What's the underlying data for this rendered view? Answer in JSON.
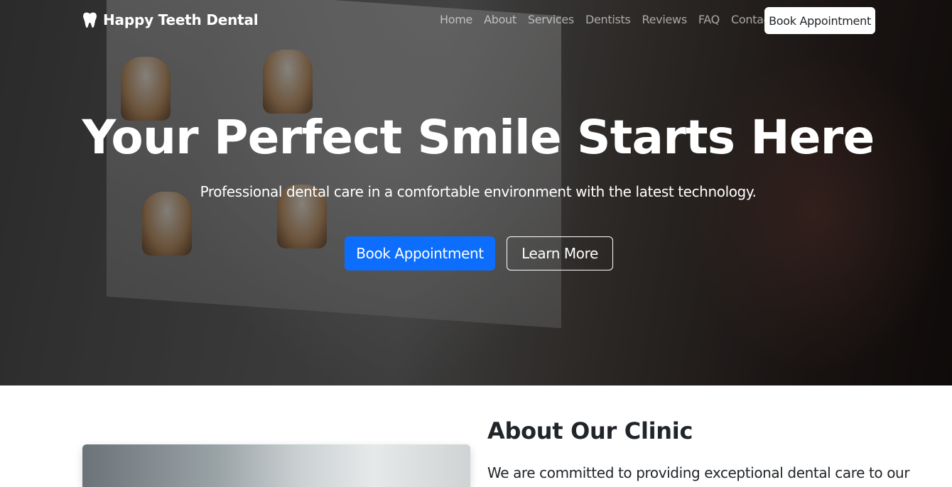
{
  "brand": {
    "name": "Happy Teeth Dental",
    "icon": "tooth-icon"
  },
  "nav": {
    "links": [
      "Home",
      "About",
      "Services",
      "Dentists",
      "Reviews",
      "FAQ",
      "Contact"
    ],
    "cta": "Book Appointment"
  },
  "hero": {
    "title": "Your Perfect Smile Starts Here",
    "subtitle": "Professional dental care in a comfortable environment with the latest technology.",
    "primary_button": "Book Appointment",
    "secondary_button": "Learn More"
  },
  "about": {
    "title": "About Our Clinic",
    "text": "We are committed to providing exceptional dental care to our"
  },
  "colors": {
    "primary": "#0d6efd",
    "text": "#212529",
    "white": "#ffffff"
  }
}
